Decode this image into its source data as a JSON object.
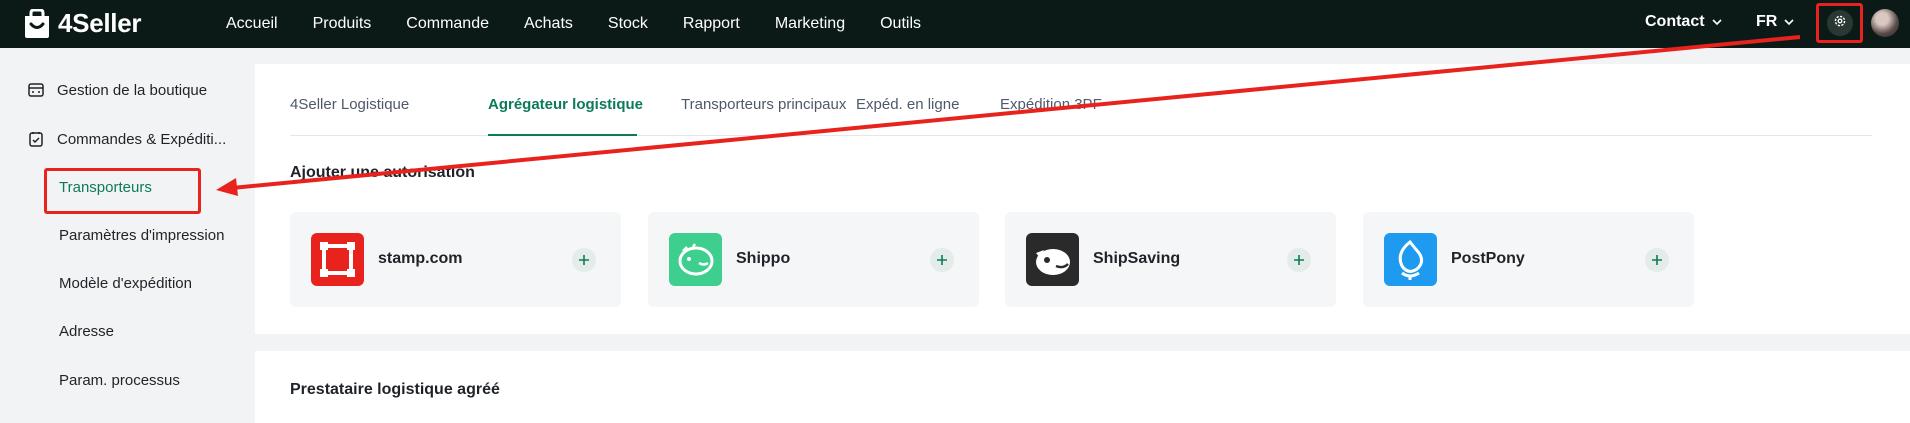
{
  "app": {
    "brand": "4Seller"
  },
  "nav": {
    "items": [
      "Accueil",
      "Produits",
      "Commande",
      "Achats",
      "Stock",
      "Rapport",
      "Marketing",
      "Outils"
    ],
    "contact": "Contact",
    "language": "FR"
  },
  "sidebar": {
    "groups": [
      {
        "label": "Gestion de la boutique",
        "icon": "store-icon"
      },
      {
        "label": "Commandes & Expéditi...",
        "icon": "order-icon"
      }
    ],
    "subitems": [
      "Transporteurs",
      "Paramètres d'impression",
      "Modèle d'expédition",
      "Adresse",
      "Param. processus"
    ],
    "active": "Transporteurs"
  },
  "tabs": {
    "items": [
      "4Seller Logistique",
      "Agrégateur logistique",
      "Transporteurs principaux",
      "Expéd. en ligne",
      "Expédition 3PF"
    ],
    "active": "Agrégateur logistique"
  },
  "sections": {
    "add_authorization": "Ajouter une autorisation",
    "approved_provider": "Prestataire logistique agréé"
  },
  "providers": [
    {
      "name": "stamp.com",
      "icon": "stamp-logo-icon",
      "color": "#e8231d"
    },
    {
      "name": "Shippo",
      "icon": "shippo-logo-icon",
      "color": "#3ecf8e"
    },
    {
      "name": "ShipSaving",
      "icon": "shipsaving-logo-icon",
      "color": "#2a2a2a"
    },
    {
      "name": "PostPony",
      "icon": "postpony-logo-icon",
      "color": "#1e9bf0"
    }
  ],
  "colors": {
    "accent": "#0e7a5c",
    "topbar": "#0c1a17",
    "annotation": "#e8231d"
  }
}
